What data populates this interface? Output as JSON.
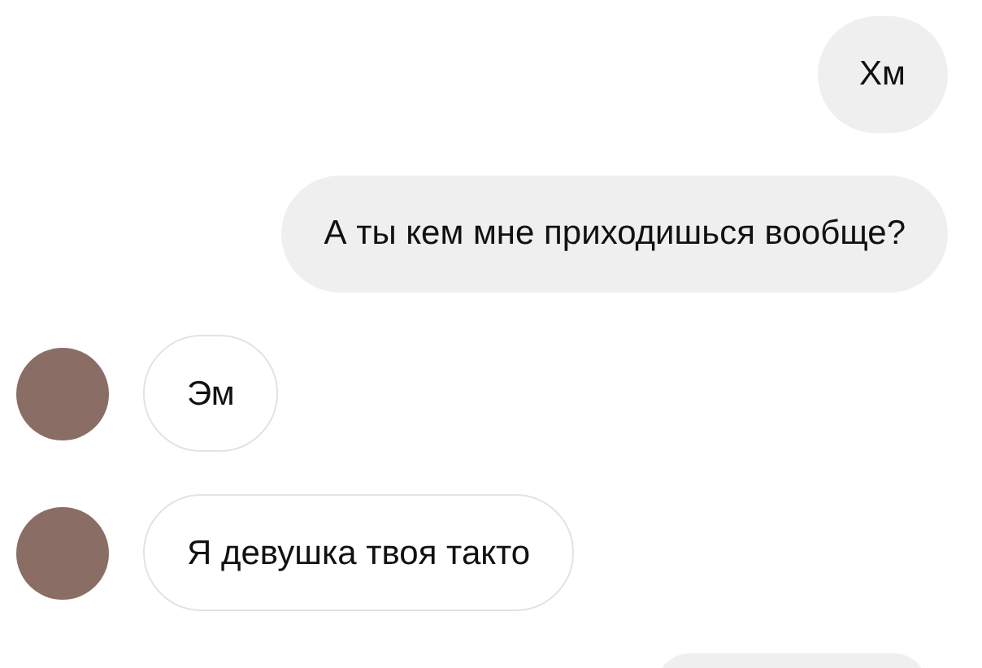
{
  "messages": [
    {
      "kind": "outgoing",
      "text": "Хм"
    },
    {
      "kind": "outgoing",
      "text": "А ты кем мне приходишься вообще?"
    },
    {
      "kind": "incoming",
      "text": "Эм"
    },
    {
      "kind": "incoming",
      "text": "Я девушка твоя такто"
    },
    {
      "kind": "outgoing",
      "cut_off": true
    }
  ]
}
